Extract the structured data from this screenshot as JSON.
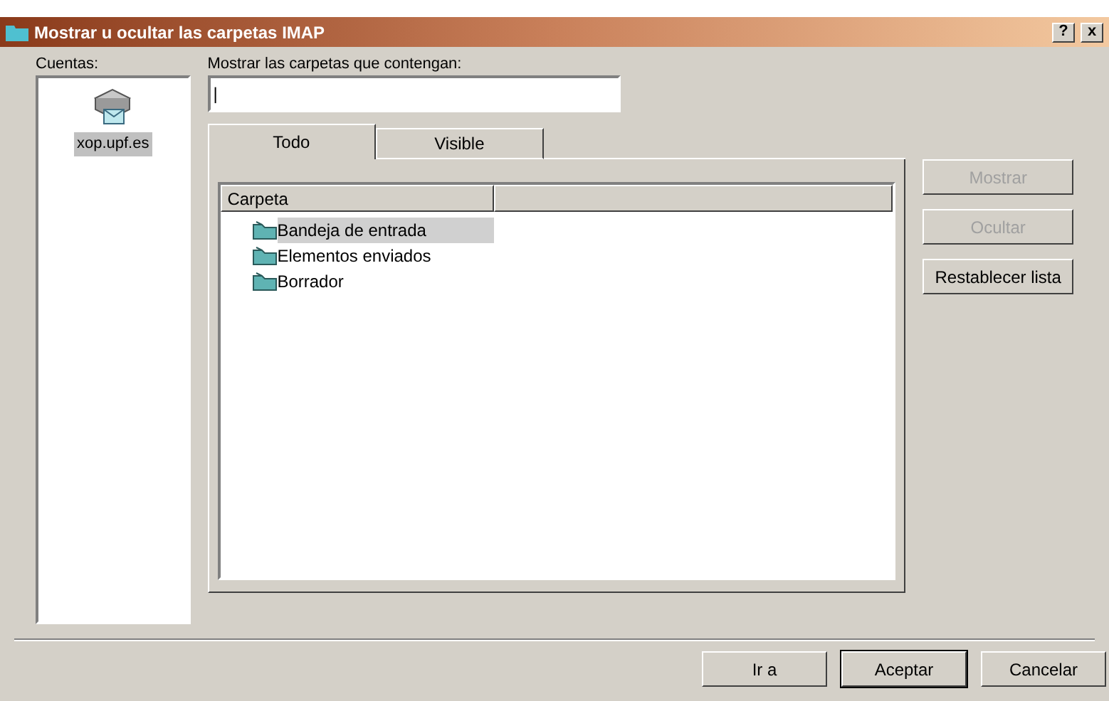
{
  "window": {
    "title": "Mostrar u ocultar las carpetas IMAP",
    "help_button": "?",
    "close_button": "x"
  },
  "accounts": {
    "label": "Cuentas:",
    "items": [
      {
        "name": "xop.upf.es",
        "selected": true
      }
    ]
  },
  "filter": {
    "label": "Mostrar las carpetas que contengan:",
    "value": "|"
  },
  "tabs": [
    {
      "label": "Todo",
      "selected": true
    },
    {
      "label": "Visible",
      "selected": false
    }
  ],
  "folders": {
    "columns": [
      "Carpeta"
    ],
    "rows": [
      {
        "name": "Bandeja de entrada",
        "selected": true
      },
      {
        "name": "Elementos enviados",
        "selected": false
      },
      {
        "name": "Borrador",
        "selected": false
      }
    ]
  },
  "side_buttons": [
    {
      "label": "Mostrar",
      "disabled": true
    },
    {
      "label": "Ocultar",
      "disabled": true
    },
    {
      "label": "Restablecer lista",
      "disabled": false
    }
  ],
  "buttons": [
    {
      "label": "Ir a",
      "default": false
    },
    {
      "label": "Aceptar",
      "default": true
    },
    {
      "label": "Cancelar",
      "default": false
    }
  ]
}
